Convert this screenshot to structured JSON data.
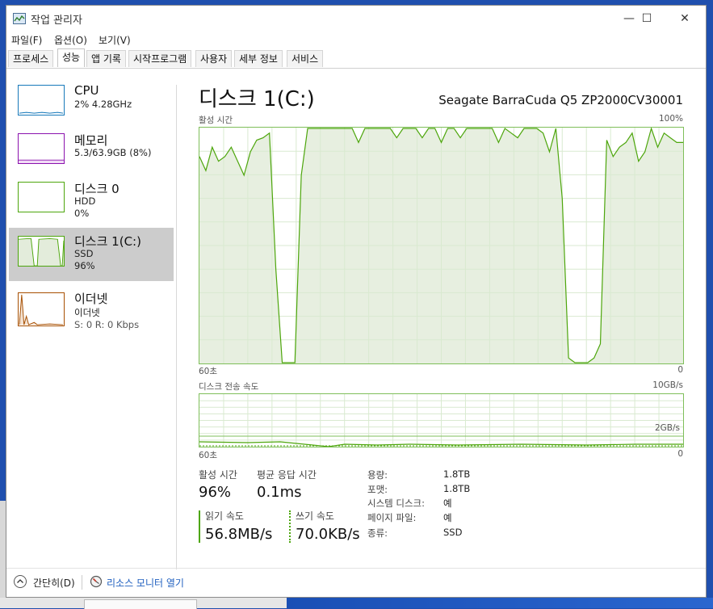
{
  "window": {
    "title": "작업 관리자"
  },
  "menu": [
    "파일(F)",
    "옵션(O)",
    "보기(V)"
  ],
  "tabs": [
    "프로세스",
    "성능",
    "앱 기록",
    "시작프로그램",
    "사용자",
    "세부 정보",
    "서비스"
  ],
  "active_tab": "성능",
  "sidebar": {
    "items": [
      {
        "title": "CPU",
        "line1": "2% 4.28GHz",
        "line2": "",
        "color": "#1779ba"
      },
      {
        "title": "메모리",
        "line1": "5.3/63.9GB (8%)",
        "line2": "",
        "color": "#8b12ae"
      },
      {
        "title": "디스크 0",
        "line1": "HDD",
        "line2": "0%",
        "color": "#4da60c"
      },
      {
        "title": "디스크 1(C:)",
        "line1": "SSD",
        "line2": "96%",
        "color": "#4da60c"
      },
      {
        "title": "이더넷",
        "line1": "이더넷",
        "line2": "S: 0 R: 0 Kbps",
        "color": "#a74f01"
      }
    ],
    "selected_index": 3
  },
  "main": {
    "title": "디스크 1(C:)",
    "model": "Seagate BarraCuda Q5 ZP2000CV30001",
    "activity_graph": {
      "label": "활성 시간",
      "max_label": "100%",
      "time_label": "60초",
      "min_label": "0"
    },
    "transfer_graph": {
      "label": "디스크 전송 속도",
      "max_label": "10GB/s",
      "mid_label": "2GB/s",
      "time_label": "60초",
      "min_label": "0"
    }
  },
  "stats": {
    "active_time": {
      "label": "활성 시간",
      "value": "96%"
    },
    "response_time": {
      "label": "평균 응답 시간",
      "value": "0.1ms"
    },
    "read_speed": {
      "label": "읽기 속도",
      "value": "56.8MB/s"
    },
    "write_speed": {
      "label": "쓰기 속도",
      "value": "70.0KB/s"
    }
  },
  "details": [
    {
      "key": "용량:",
      "value": "1.8TB"
    },
    {
      "key": "포맷:",
      "value": "1.8TB"
    },
    {
      "key": "시스템 디스크:",
      "value": "예"
    },
    {
      "key": "페이지 파일:",
      "value": "예"
    },
    {
      "key": "종류:",
      "value": "SSD"
    }
  ],
  "footer": {
    "fewer_details": "간단히(D)",
    "resource_monitor": "리소스 모니터 열기"
  },
  "colors": {
    "disk_line": "#4da60c",
    "disk_fill": "#e3ecdb",
    "grid": "#d9ead0"
  },
  "activity_series": [
    88,
    82,
    92,
    86,
    88,
    92,
    86,
    80,
    90,
    95,
    96,
    98,
    40,
    0,
    0,
    0,
    80,
    100,
    100,
    100,
    100,
    100,
    100,
    100,
    100,
    94,
    100,
    100,
    100,
    100,
    100,
    96,
    100,
    100,
    100,
    96,
    100,
    100,
    94,
    100,
    100,
    96,
    100,
    100,
    100,
    100,
    100,
    94,
    100,
    98,
    96,
    100,
    100,
    100,
    98,
    90,
    100,
    70,
    2,
    0,
    0,
    0,
    2,
    8,
    95,
    88,
    92,
    94,
    98,
    86,
    90,
    100,
    92,
    98,
    96,
    94,
    94
  ]
}
